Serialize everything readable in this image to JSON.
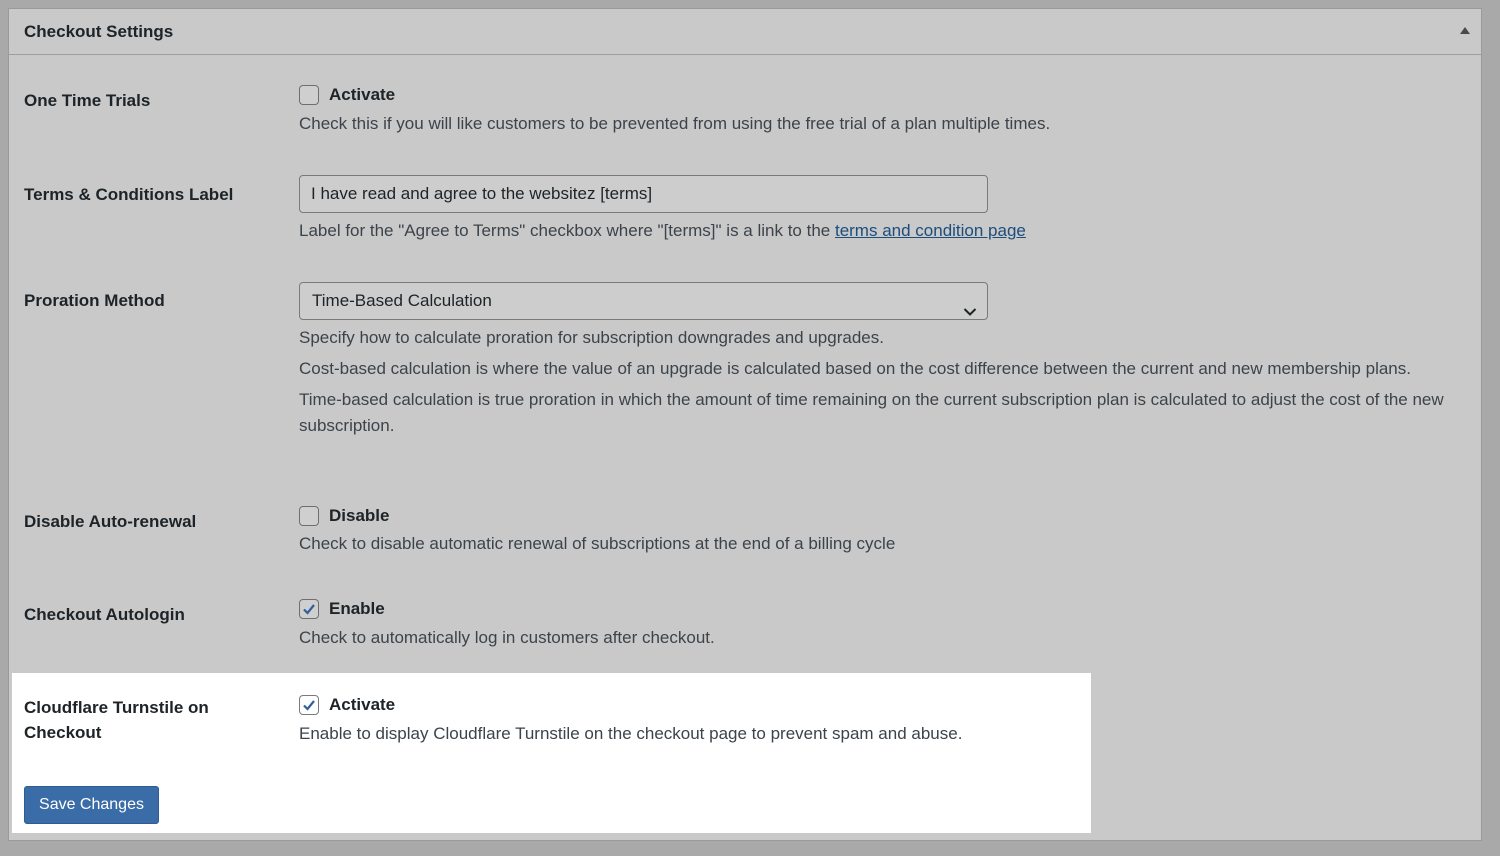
{
  "panel": {
    "title": "Checkout Settings"
  },
  "rows": {
    "one_time_trials": {
      "label": "One Time Trials",
      "checkbox_label": "Activate",
      "checked": false,
      "description": "Check this if you will like customers to be prevented from using the free trial of a plan multiple times."
    },
    "terms_label": {
      "label": "Terms & Conditions Label",
      "input_value": "I have read and agree to the websitez [terms]",
      "description_prefix": "Label for the \"Agree to Terms\" checkbox where \"[terms]\" is a link to the ",
      "description_link": "terms and condition page"
    },
    "proration": {
      "label": "Proration Method",
      "selected": "Time-Based Calculation",
      "desc1": "Specify how to calculate proration for subscription downgrades and upgrades.",
      "desc2": "Cost-based calculation is where the value of an upgrade is calculated based on the cost difference between the current and new membership plans.",
      "desc3": "Time-based calculation is true proration in which the amount of time remaining on the current subscription plan is calculated to adjust the cost of the new subscription."
    },
    "auto_renewal": {
      "label": "Disable Auto-renewal",
      "checkbox_label": "Disable",
      "checked": false,
      "description": "Check to disable automatic renewal of subscriptions at the end of a billing cycle"
    },
    "autologin": {
      "label": "Checkout Autologin",
      "checkbox_label": "Enable",
      "checked": true,
      "description": "Check to automatically log in customers after checkout."
    },
    "turnstile": {
      "label_line1": "Cloudflare Turnstile on",
      "label_line2": "Checkout",
      "checkbox_label": "Activate",
      "checked": true,
      "description": "Enable to display Cloudflare Turnstile on the checkout page to prevent spam and abuse."
    }
  },
  "actions": {
    "save_label": "Save Changes"
  },
  "colors": {
    "accent": "#3a6ca7",
    "link": "#1c4d7c",
    "checkmark": "#2f5f9c"
  }
}
